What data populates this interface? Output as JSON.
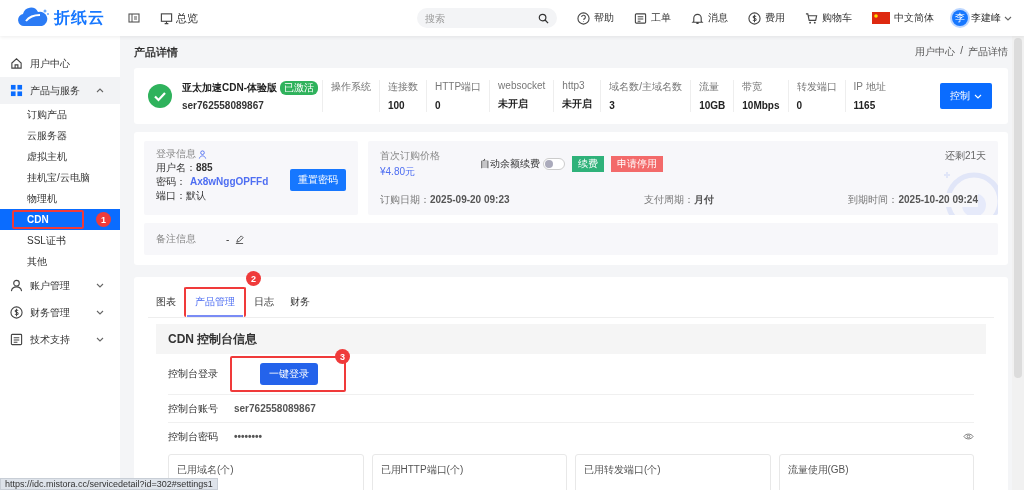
{
  "header": {
    "logo": "折纸云",
    "overview": "总览",
    "search": {
      "placeholder": "搜索"
    },
    "actions": [
      {
        "kind": "help",
        "label": "帮助"
      },
      {
        "kind": "ticket",
        "label": "工单"
      },
      {
        "kind": "bell",
        "label": "消息"
      },
      {
        "kind": "dollar",
        "label": "费用"
      },
      {
        "kind": "cart",
        "label": "购物车"
      },
      {
        "kind": "flag",
        "label": "中文简体"
      }
    ],
    "user": {
      "avatar": "李",
      "name": "李建峰"
    }
  },
  "sidebar": {
    "items": [
      {
        "kind": "home",
        "label": "用户中心"
      },
      {
        "kind": "grid",
        "label": "产品与服务",
        "expanded": true,
        "children": [
          {
            "label": "订购产品",
            "selected": false
          },
          {
            "label": "云服务器",
            "selected": false
          },
          {
            "label": "虚拟主机",
            "selected": false
          },
          {
            "label": "挂机宝/云电脑",
            "selected": false
          },
          {
            "label": "物理机",
            "selected": false
          },
          {
            "label": "CDN",
            "selected": true
          },
          {
            "label": "SSL证书",
            "selected": false
          },
          {
            "label": "其他",
            "selected": false
          }
        ]
      },
      {
        "kind": "user",
        "label": "账户管理",
        "expanded": false
      },
      {
        "kind": "dollar",
        "label": "财务管理",
        "expanded": false
      },
      {
        "kind": "doc",
        "label": "技术支持",
        "expanded": false
      }
    ]
  },
  "page": {
    "title": "产品详情",
    "breadcrumb": [
      "用户中心",
      "产品详情"
    ],
    "breadcrumb_separator": "/"
  },
  "product": {
    "name": "亚太加速CDN-体验版",
    "status": "已激活",
    "id": "ser762558089867",
    "stats": [
      {
        "label": "操作系统"
      },
      {
        "label": "连接数",
        "value": "100"
      },
      {
        "label": "HTTP端口",
        "value": "0"
      },
      {
        "label": "websocket",
        "value": "未开启"
      },
      {
        "label": "http3",
        "value": "未开启"
      },
      {
        "label": "域名数/主域名数",
        "value": "3"
      },
      {
        "label": "流量",
        "value": "10GB"
      },
      {
        "label": "带宽",
        "value": "10Mbps"
      },
      {
        "label": "转发端口",
        "value": "0"
      },
      {
        "label": "IP 地址",
        "value": "1165"
      }
    ],
    "control_button": "控制"
  },
  "login_info": {
    "title": "登录信息",
    "fields": [
      {
        "label": "用户名：",
        "value": "885",
        "kind": "plain"
      },
      {
        "label": "密码：",
        "value": "Ax8wNggOPFFd",
        "kind": "link"
      },
      {
        "label": "端口：",
        "value": "默认",
        "kind": "plain"
      }
    ],
    "reset_button": "重置密码"
  },
  "billing": {
    "price_label": "首次订购价格",
    "price": "¥4.80元",
    "auto_renew": {
      "label": "自动余额续费",
      "on": false
    },
    "renew_button": "续费",
    "stop_button": "申请停用",
    "remaining": "还剩21天",
    "details": [
      {
        "label": "订购日期：",
        "value": "2025-09-20 09:23"
      },
      {
        "label": "支付周期：",
        "value": "月付"
      },
      {
        "label": "到期时间：",
        "value": "2025-10-20 09:24"
      }
    ]
  },
  "notes": {
    "label": "备注信息",
    "value": "-"
  },
  "tabs": [
    {
      "label": "图表",
      "selected": false
    },
    {
      "label": "产品管理",
      "selected": true
    },
    {
      "label": "日志",
      "selected": false
    },
    {
      "label": "财务",
      "selected": false
    }
  ],
  "console": {
    "title": "CDN 控制台信息",
    "login_label": "控制台登录",
    "login_button": "一键登录",
    "account_label": "控制台账号",
    "account": "ser762558089867",
    "password_label": "控制台密码",
    "password": "••••••••",
    "usage_cards": [
      "已用域名(个)",
      "已用HTTP端口(个)",
      "已用转发端口(个)",
      "流量使用(GB)"
    ]
  },
  "annotations": [
    {
      "label": "1"
    },
    {
      "label": "2"
    },
    {
      "label": "3"
    }
  ],
  "status_bar": "https://idc.mistora.cc/servicedetail?id=302#settings1"
}
